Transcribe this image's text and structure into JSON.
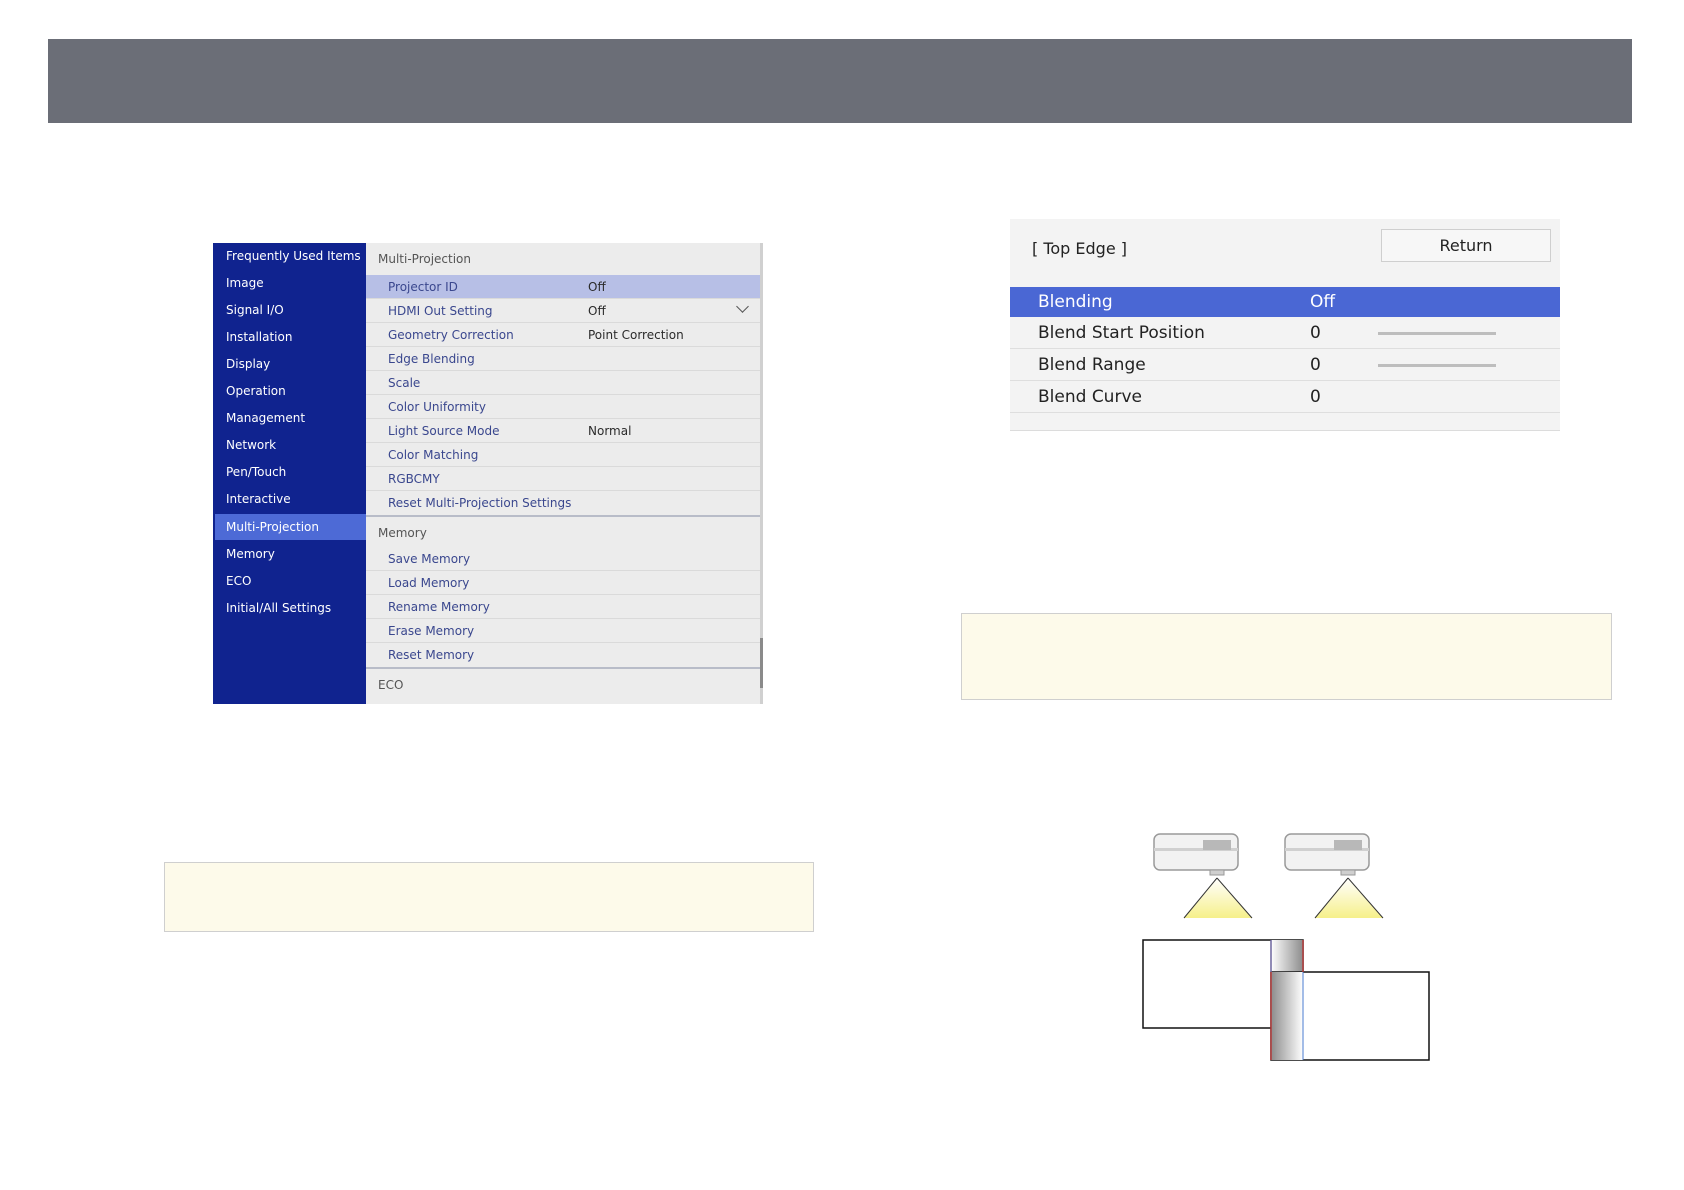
{
  "left_menu": {
    "sidebar_items": [
      "Frequently Used Items",
      "Image",
      "Signal I/O",
      "Installation",
      "Display",
      "Operation",
      "Management",
      "Network",
      "Pen/Touch",
      "Interactive",
      "Multi-Projection",
      "Memory",
      "ECO",
      "Initial/All Settings"
    ],
    "selected_sidebar": "Multi-Projection",
    "sections": {
      "multi_projection": {
        "header": "Multi-Projection",
        "rows": [
          {
            "label": "Projector ID",
            "value": "Off"
          },
          {
            "label": "HDMI Out Setting",
            "value": "Off"
          },
          {
            "label": "Geometry Correction",
            "value": "Point Correction"
          },
          {
            "label": "Edge Blending",
            "value": ""
          },
          {
            "label": "Scale",
            "value": ""
          },
          {
            "label": "Color Uniformity",
            "value": ""
          },
          {
            "label": "Light Source Mode",
            "value": "Normal"
          },
          {
            "label": "Color Matching",
            "value": ""
          },
          {
            "label": "RGBCMY",
            "value": ""
          },
          {
            "label": "Reset Multi-Projection Settings",
            "value": ""
          }
        ]
      },
      "memory": {
        "header": "Memory",
        "rows": [
          {
            "label": "Save Memory"
          },
          {
            "label": "Load Memory"
          },
          {
            "label": "Rename Memory"
          },
          {
            "label": "Erase Memory"
          },
          {
            "label": "Reset Memory"
          }
        ]
      },
      "eco": {
        "header": "ECO"
      }
    }
  },
  "edge_menu": {
    "title": "[ Top Edge ]",
    "return_label": "Return",
    "rows": [
      {
        "label": "Blending",
        "value": "Off"
      },
      {
        "label": "Blend Start Position",
        "value": "0"
      },
      {
        "label": "Blend Range",
        "value": "0"
      },
      {
        "label": "Blend Curve",
        "value": "0"
      }
    ]
  },
  "colors": {
    "topbar": "#6b6e77",
    "sidebar": "#10238f",
    "sidebar_selected": "#4d6ad6",
    "row_selected": "#b7bfe6",
    "edge_selected": "#4a67d4",
    "note_bg": "#fdfaea"
  }
}
